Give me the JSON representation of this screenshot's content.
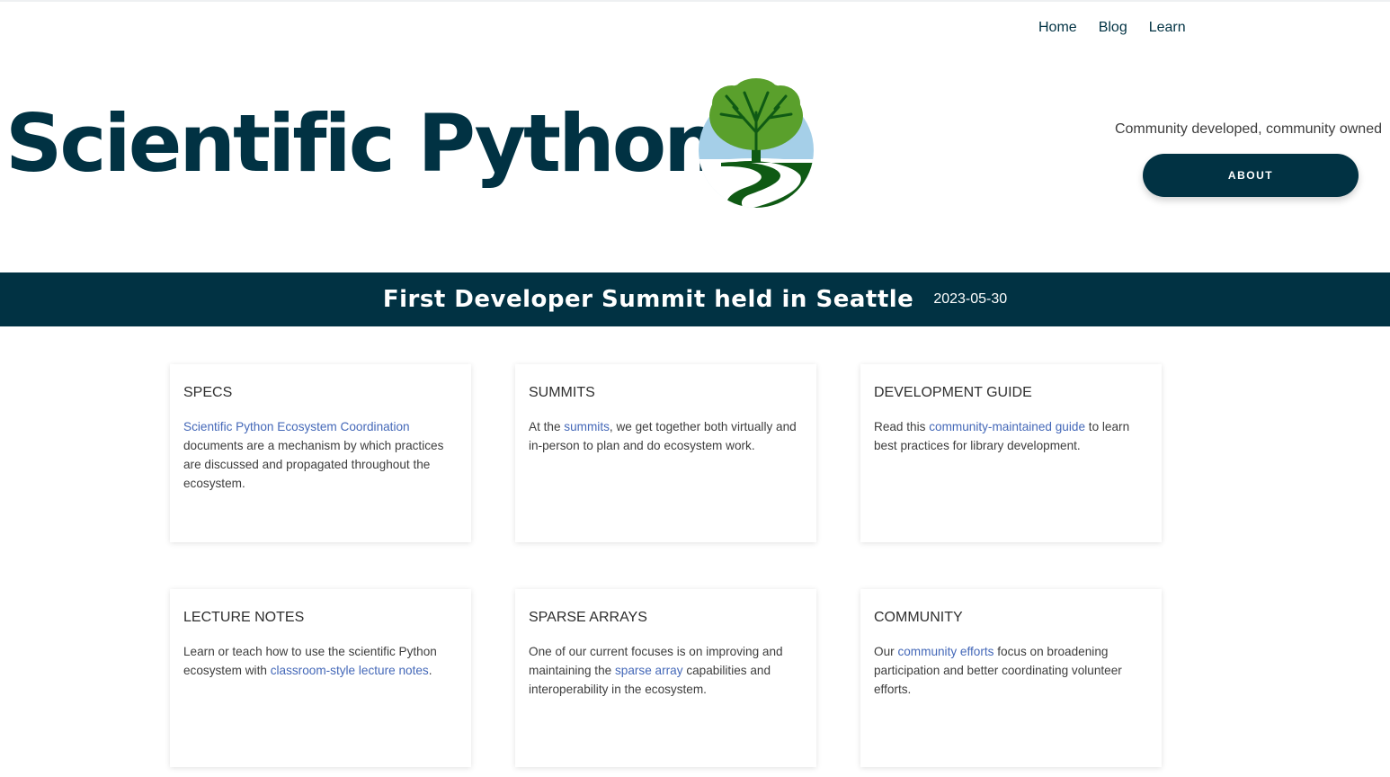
{
  "nav": {
    "items": [
      {
        "label": "Home"
      },
      {
        "label": "Blog"
      },
      {
        "label": "Learn"
      }
    ]
  },
  "hero": {
    "title": "Scientific Python",
    "tagline": "Community developed, community owned",
    "about_label": "ABOUT"
  },
  "banner": {
    "title": "First Developer Summit held in Seattle",
    "date": "2023-05-30"
  },
  "colors": {
    "brand": "#013243",
    "link": "#4468b8",
    "tree_green": "#5aa02c",
    "river_green": "#0f5a14",
    "sky_blue": "#a5cfe8"
  },
  "cards": [
    {
      "title": "SPECS",
      "before": "",
      "link": "Scientific Python Ecosystem Coordination",
      "after": " documents are a mechanism by which practices are discussed and propagated throughout the ecosystem."
    },
    {
      "title": "SUMMITS",
      "before": "At the ",
      "link": "summits",
      "after": ", we get together both virtually and in-person to plan and do ecosystem work."
    },
    {
      "title": "DEVELOPMENT GUIDE",
      "before": "Read this ",
      "link": "community-maintained guide",
      "after": " to learn best practices for library development."
    },
    {
      "title": "LECTURE NOTES",
      "before": "Learn or teach how to use the scientific Python ecosystem with ",
      "link": "classroom-style lecture notes",
      "after": "."
    },
    {
      "title": "SPARSE ARRAYS",
      "before": "One of our current focuses is on improving and maintaining the ",
      "link": "sparse array",
      "after": " capabilities and interoperability in the ecosystem."
    },
    {
      "title": "COMMUNITY",
      "before": "Our ",
      "link": "community efforts",
      "after": " focus on broadening participation and better coordinating volunteer efforts."
    }
  ]
}
